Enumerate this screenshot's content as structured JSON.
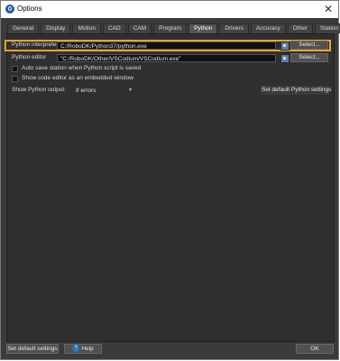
{
  "window": {
    "title": "Options",
    "close": "✕"
  },
  "tabs": [
    {
      "label": "General"
    },
    {
      "label": "Display"
    },
    {
      "label": "Motion"
    },
    {
      "label": "CAD"
    },
    {
      "label": "CAM"
    },
    {
      "label": "Program"
    },
    {
      "label": "Python"
    },
    {
      "label": "Drivers"
    },
    {
      "label": "Accuracy"
    },
    {
      "label": "Other"
    },
    {
      "label": "Station"
    }
  ],
  "active_tab": "Python",
  "python": {
    "interpreter_label": "Python interpreter",
    "interpreter_path": "C:/RoboDK/Python37/python.exe",
    "interpreter_select": "Select...",
    "editor_label": "Python editor",
    "editor_path": "\"C:/RoboDK/Other/VSCodium/VSCodium.exe\"",
    "editor_select": "Select...",
    "auto_save_label": "Auto save station when Python script is saved",
    "embedded_editor_label": "Show code editor as an embedded window",
    "show_output_label": "Show Python output:",
    "show_output_value": "If errors",
    "set_default_python": "Set default Python settings"
  },
  "footer": {
    "set_default_settings": "Set default settings",
    "help": "Help",
    "ok": "OK"
  },
  "colors": {
    "highlight": "#f0a32a",
    "background": "#3b3b3b"
  }
}
